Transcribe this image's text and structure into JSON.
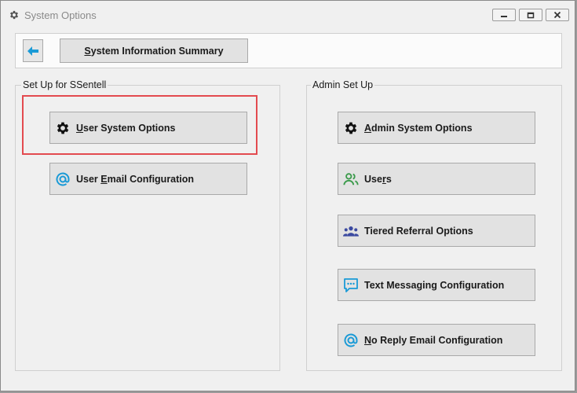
{
  "window": {
    "title": "System Options",
    "icon": "gear-icon"
  },
  "toolbar": {
    "back_icon": "arrow-left-icon",
    "summary_pre": "",
    "summary_ul": "S",
    "summary_post": "ystem Information Summary"
  },
  "groups": {
    "user": {
      "label": "Set Up for SSentell",
      "buttons": [
        {
          "pre": "",
          "ul": "U",
          "post": "ser System Options",
          "icon": "gear-icon"
        },
        {
          "pre": "User ",
          "ul": "E",
          "post": "mail Configuration",
          "icon": "at-sign-icon"
        }
      ]
    },
    "admin": {
      "label": "Admin Set Up",
      "buttons": [
        {
          "pre": "",
          "ul": "A",
          "post": "dmin System Options",
          "icon": "gear-icon"
        },
        {
          "pre": "Use",
          "ul": "r",
          "post": "s",
          "icon": "users-icon"
        },
        {
          "pre": "Tiered Referral Options",
          "ul": "",
          "post": "",
          "icon": "group-icon"
        },
        {
          "pre": "Text Messaging Configuration",
          "ul": "",
          "post": "",
          "icon": "chat-icon"
        },
        {
          "pre": "",
          "ul": "N",
          "post": "o Reply Email Configuration",
          "icon": "at-sign-icon"
        }
      ]
    }
  },
  "colors": {
    "accent_blue": "#1a9ad6",
    "highlight_red": "#e34a4f",
    "users_green": "#3a9a4a",
    "group_navy": "#3b4aa0"
  }
}
